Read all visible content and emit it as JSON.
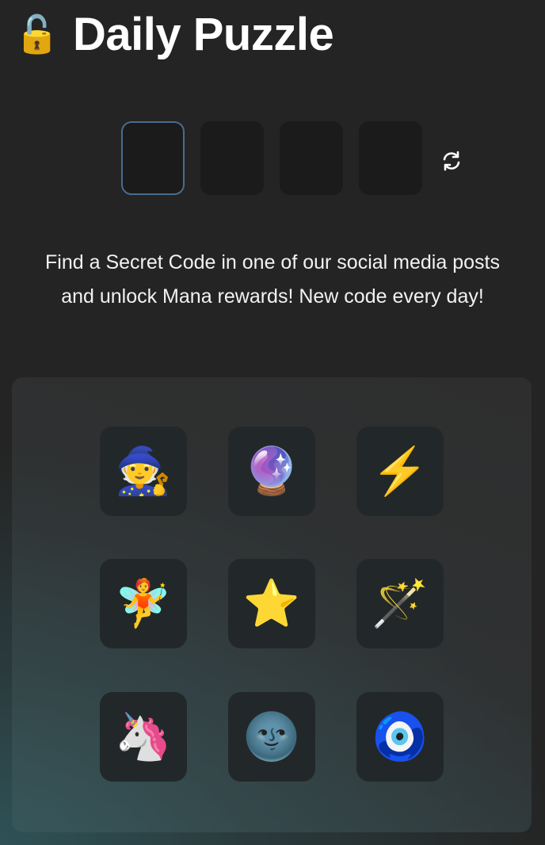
{
  "header": {
    "icon": "unlocked-padlock-icon",
    "lock_glyph": "🔓",
    "title": "Daily Puzzle"
  },
  "code_input": {
    "slots": [
      "",
      "",
      "",
      ""
    ],
    "active_slot": 0,
    "refresh_icon": "refresh-icon"
  },
  "description": {
    "line1": "Find a Secret Code in one of our social media posts",
    "line2": "and unlock Mana rewards! New code every day!"
  },
  "emoji_grid": [
    {
      "name": "mage",
      "glyph": "🧙"
    },
    {
      "name": "crystal-ball",
      "glyph": "🔮"
    },
    {
      "name": "lightning",
      "glyph": "⚡"
    },
    {
      "name": "fairy",
      "glyph": "🧚"
    },
    {
      "name": "star",
      "glyph": "⭐"
    },
    {
      "name": "magic-wand",
      "glyph": "🪄"
    },
    {
      "name": "unicorn",
      "glyph": "🦄"
    },
    {
      "name": "new-moon-face",
      "glyph": "🌚"
    },
    {
      "name": "nazar-amulet",
      "glyph": "🧿"
    }
  ],
  "colors": {
    "background": "#242424",
    "active_border": "#4a6b8e",
    "slot_bg": "#1b1b1b",
    "tile_bg": "#222829"
  }
}
